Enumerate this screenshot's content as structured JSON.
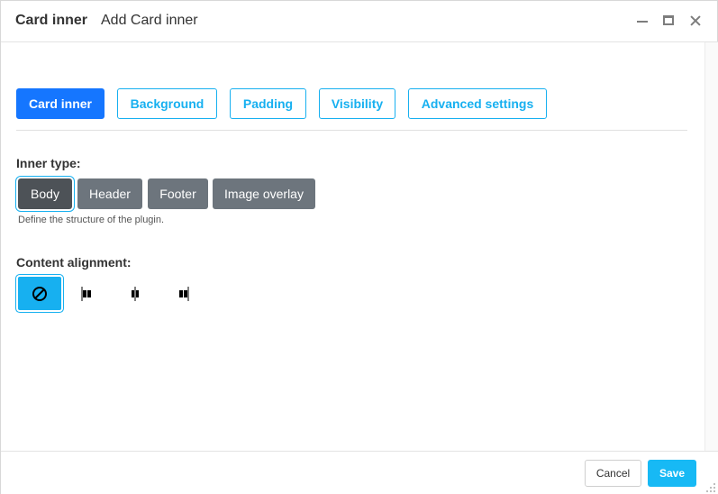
{
  "window": {
    "title": "Card inner",
    "subtitle": "Add Card inner"
  },
  "tabs": [
    {
      "label": "Card inner",
      "active": true
    },
    {
      "label": "Background",
      "active": false
    },
    {
      "label": "Padding",
      "active": false
    },
    {
      "label": "Visibility",
      "active": false
    },
    {
      "label": "Advanced settings",
      "active": false
    }
  ],
  "inner_type": {
    "label": "Inner type:",
    "options": [
      "Body",
      "Header",
      "Footer",
      "Image overlay"
    ],
    "selected": "Body",
    "help": "Define the structure of the plugin."
  },
  "content_alignment": {
    "label": "Content alignment:",
    "options": [
      {
        "icon": "no-alignment-icon",
        "active": true
      },
      {
        "icon": "align-left-icon",
        "active": false
      },
      {
        "icon": "align-center-icon",
        "active": false
      },
      {
        "icon": "align-right-icon",
        "active": false
      }
    ]
  },
  "footer": {
    "cancel_label": "Cancel",
    "save_label": "Save"
  },
  "colors": {
    "active_tab": "#1576ff",
    "accent": "#17b0f0",
    "segment": "#6d757d",
    "segment_active": "#4d5257",
    "save": "#17b9f5"
  }
}
